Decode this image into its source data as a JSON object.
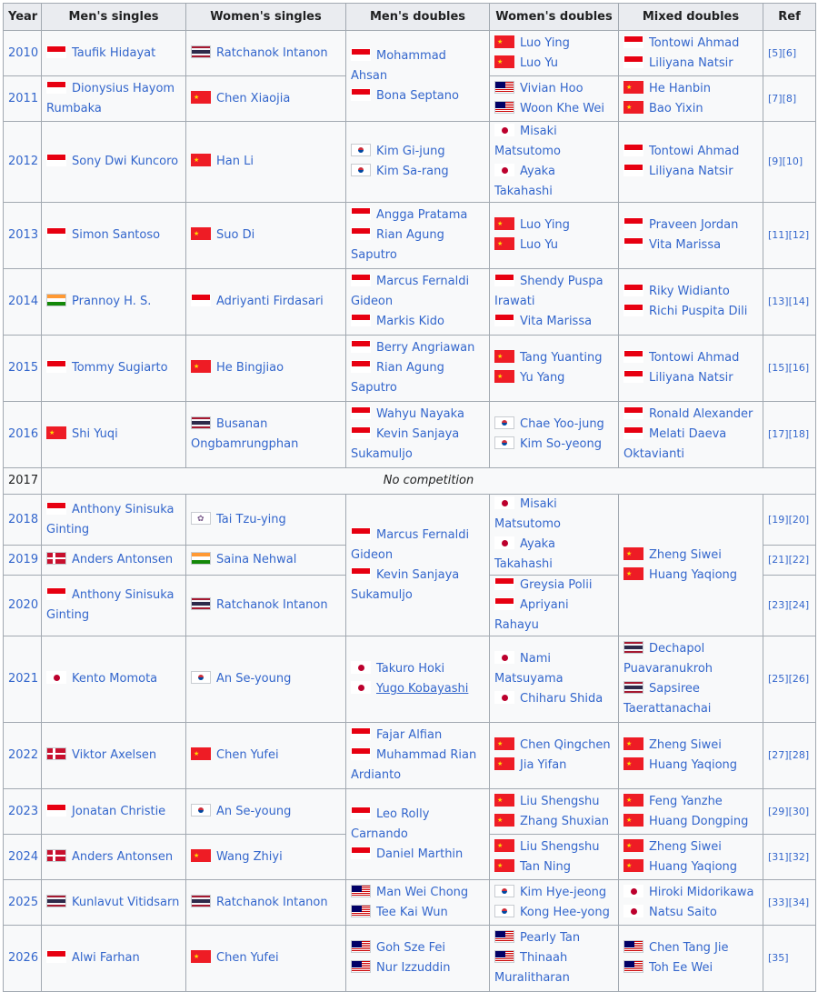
{
  "headers": [
    "Year",
    "Men's singles",
    "Women's singles",
    "Men's doubles",
    "Women's doubles",
    "Mixed doubles",
    "Ref"
  ],
  "no_competition": "No competition",
  "rows": [
    {
      "year": "2010",
      "ms": {
        "f": "IDN",
        "n": "Taufik Hidayat"
      },
      "ws": {
        "f": "THA",
        "n": "Ratchanok Intanon"
      },
      "md": [
        {
          "f": "IDN",
          "n": "Mohammad Ahsan"
        },
        {
          "f": "IDN",
          "n": "Bona Septano"
        }
      ],
      "wd": [
        {
          "f": "CHN",
          "n": "Luo Ying"
        },
        {
          "f": "CHN",
          "n": "Luo Yu"
        }
      ],
      "xd": [
        {
          "f": "IDN",
          "n": "Tontowi Ahmad"
        },
        {
          "f": "IDN",
          "n": "Liliyana Natsir"
        }
      ],
      "ref": "[5][6]"
    },
    {
      "year": "2011",
      "ms": {
        "f": "IDN",
        "n": "Dionysius Hayom Rumbaka"
      },
      "ws": {
        "f": "CHN",
        "n": "Chen Xiaojia"
      },
      "wd": [
        {
          "f": "MAS",
          "n": "Vivian Hoo"
        },
        {
          "f": "MAS",
          "n": "Woon Khe Wei"
        }
      ],
      "xd": [
        {
          "f": "CHN",
          "n": "He Hanbin"
        },
        {
          "f": "CHN",
          "n": "Bao Yixin"
        }
      ],
      "ref": "[7][8]"
    },
    {
      "year": "2012",
      "ms": {
        "f": "IDN",
        "n": "Sony Dwi Kuncoro"
      },
      "ws": {
        "f": "CHN",
        "n": "Han Li"
      },
      "md": [
        {
          "f": "KOR",
          "n": "Kim Gi-jung"
        },
        {
          "f": "KOR",
          "n": "Kim Sa-rang"
        }
      ],
      "wd": [
        {
          "f": "JPN",
          "n": "Misaki Matsutomo"
        },
        {
          "f": "JPN",
          "n": "Ayaka Takahashi"
        }
      ],
      "xd": [
        {
          "f": "IDN",
          "n": "Tontowi Ahmad"
        },
        {
          "f": "IDN",
          "n": "Liliyana Natsir"
        }
      ],
      "ref": "[9][10]"
    },
    {
      "year": "2013",
      "ms": {
        "f": "IDN",
        "n": "Simon Santoso"
      },
      "ws": {
        "f": "CHN",
        "n": "Suo Di"
      },
      "md": [
        {
          "f": "IDN",
          "n": "Angga Pratama"
        },
        {
          "f": "IDN",
          "n": "Rian Agung Saputro"
        }
      ],
      "wd": [
        {
          "f": "CHN",
          "n": "Luo Ying"
        },
        {
          "f": "CHN",
          "n": "Luo Yu"
        }
      ],
      "xd": [
        {
          "f": "IDN",
          "n": "Praveen Jordan"
        },
        {
          "f": "IDN",
          "n": "Vita Marissa"
        }
      ],
      "ref": "[11][12]"
    },
    {
      "year": "2014",
      "ms": {
        "f": "IND",
        "n": "Prannoy H. S."
      },
      "ws": {
        "f": "IDN",
        "n": "Adriyanti Firdasari"
      },
      "md": [
        {
          "f": "IDN",
          "n": "Marcus Fernaldi Gideon"
        },
        {
          "f": "IDN",
          "n": "Markis Kido"
        }
      ],
      "wd": [
        {
          "f": "IDN",
          "n": "Shendy Puspa Irawati"
        },
        {
          "f": "IDN",
          "n": "Vita Marissa"
        }
      ],
      "xd": [
        {
          "f": "IDN",
          "n": "Riky Widianto"
        },
        {
          "f": "IDN",
          "n": "Richi Puspita Dili"
        }
      ],
      "ref": "[13][14]"
    },
    {
      "year": "2015",
      "ms": {
        "f": "IDN",
        "n": "Tommy Sugiarto"
      },
      "ws": {
        "f": "CHN",
        "n": "He Bingjiao"
      },
      "md": [
        {
          "f": "IDN",
          "n": "Berry Angriawan"
        },
        {
          "f": "IDN",
          "n": "Rian Agung Saputro"
        }
      ],
      "wd": [
        {
          "f": "CHN",
          "n": "Tang Yuanting"
        },
        {
          "f": "CHN",
          "n": "Yu Yang"
        }
      ],
      "xd": [
        {
          "f": "IDN",
          "n": "Tontowi Ahmad"
        },
        {
          "f": "IDN",
          "n": "Liliyana Natsir"
        }
      ],
      "ref": "[15][16]"
    },
    {
      "year": "2016",
      "ms": {
        "f": "CHN",
        "n": "Shi Yuqi"
      },
      "ws": {
        "f": "THA",
        "n": "Busanan Ongbamrungphan"
      },
      "md": [
        {
          "f": "IDN",
          "n": "Wahyu Nayaka"
        },
        {
          "f": "IDN",
          "n": "Kevin Sanjaya Sukamuljo"
        }
      ],
      "wd": [
        {
          "f": "KOR",
          "n": "Chae Yoo-jung"
        },
        {
          "f": "KOR",
          "n": "Kim So-yeong"
        }
      ],
      "xd": [
        {
          "f": "IDN",
          "n": "Ronald Alexander"
        },
        {
          "f": "IDN",
          "n": "Melati Daeva Oktavianti"
        }
      ],
      "ref": "[17][18]"
    },
    {
      "year": "2017"
    },
    {
      "year": "2018",
      "ms": {
        "f": "IDN",
        "n": "Anthony Sinisuka Ginting"
      },
      "ws": {
        "f": "TPE",
        "n": "Tai Tzu-ying"
      },
      "md": [
        {
          "f": "IDN",
          "n": "Marcus Fernaldi Gideon"
        },
        {
          "f": "IDN",
          "n": "Kevin Sanjaya Sukamuljo"
        }
      ],
      "wd": [
        {
          "f": "JPN",
          "n": "Misaki Matsutomo"
        },
        {
          "f": "JPN",
          "n": "Ayaka Takahashi"
        }
      ],
      "xd": [
        {
          "f": "CHN",
          "n": "Zheng Siwei"
        },
        {
          "f": "CHN",
          "n": "Huang Yaqiong"
        }
      ],
      "ref": "[19][20]"
    },
    {
      "year": "2019",
      "ms": {
        "f": "DEN",
        "n": "Anders Antonsen"
      },
      "ws": {
        "f": "IND",
        "n": "Saina Nehwal"
      },
      "ref": "[21][22]"
    },
    {
      "year": "2020",
      "ms": {
        "f": "IDN",
        "n": "Anthony Sinisuka Ginting"
      },
      "ws": {
        "f": "THA",
        "n": "Ratchanok Intanon"
      },
      "wd": [
        {
          "f": "IDN",
          "n": "Greysia Polii"
        },
        {
          "f": "IDN",
          "n": "Apriyani Rahayu"
        }
      ],
      "ref": "[23][24]"
    },
    {
      "year": "2021",
      "ms": {
        "f": "JPN",
        "n": "Kento Momota"
      },
      "ws": {
        "f": "KOR",
        "n": "An Se-young"
      },
      "md": [
        {
          "f": "JPN",
          "n": "Takuro Hoki"
        },
        {
          "f": "JPN",
          "n": "Yugo Kobayashi"
        }
      ],
      "wd": [
        {
          "f": "JPN",
          "n": "Nami Matsuyama"
        },
        {
          "f": "JPN",
          "n": "Chiharu Shida"
        }
      ],
      "xd": [
        {
          "f": "THA",
          "n": "Dechapol Puavaranukroh"
        },
        {
          "f": "THA",
          "n": "Sapsiree Taerattanachai"
        }
      ],
      "ref": "[25][26]"
    },
    {
      "year": "2022",
      "ms": {
        "f": "DEN",
        "n": "Viktor Axelsen"
      },
      "ws": {
        "f": "CHN",
        "n": "Chen Yufei"
      },
      "md": [
        {
          "f": "IDN",
          "n": "Fajar Alfian"
        },
        {
          "f": "IDN",
          "n": "Muhammad Rian Ardianto"
        }
      ],
      "wd": [
        {
          "f": "CHN",
          "n": "Chen Qingchen"
        },
        {
          "f": "CHN",
          "n": "Jia Yifan"
        }
      ],
      "xd": [
        {
          "f": "CHN",
          "n": "Zheng Siwei"
        },
        {
          "f": "CHN",
          "n": "Huang Yaqiong"
        }
      ],
      "ref": "[27][28]"
    },
    {
      "year": "2023",
      "ms": {
        "f": "IDN",
        "n": "Jonatan Christie"
      },
      "ws": {
        "f": "KOR",
        "n": "An Se-young"
      },
      "md": [
        {
          "f": "IDN",
          "n": "Leo Rolly Carnando"
        },
        {
          "f": "IDN",
          "n": "Daniel Marthin"
        }
      ],
      "wd": [
        {
          "f": "CHN",
          "n": "Liu Shengshu"
        },
        {
          "f": "CHN",
          "n": "Zhang Shuxian"
        }
      ],
      "xd": [
        {
          "f": "CHN",
          "n": "Feng Yanzhe"
        },
        {
          "f": "CHN",
          "n": "Huang Dongping"
        }
      ],
      "ref": "[29][30]"
    },
    {
      "year": "2024",
      "ms": {
        "f": "DEN",
        "n": "Anders Antonsen"
      },
      "ws": {
        "f": "CHN",
        "n": "Wang Zhiyi"
      },
      "wd": [
        {
          "f": "CHN",
          "n": "Liu Shengshu"
        },
        {
          "f": "CHN",
          "n": "Tan Ning"
        }
      ],
      "xd": [
        {
          "f": "CHN",
          "n": "Zheng Siwei"
        },
        {
          "f": "CHN",
          "n": "Huang Yaqiong"
        }
      ],
      "ref": "[31][32]"
    },
    {
      "year": "2025",
      "ms": {
        "f": "THA",
        "n": "Kunlavut Vitidsarn"
      },
      "ws": {
        "f": "THA",
        "n": "Ratchanok Intanon"
      },
      "md": [
        {
          "f": "MAS",
          "n": "Man Wei Chong"
        },
        {
          "f": "MAS",
          "n": "Tee Kai Wun"
        }
      ],
      "wd": [
        {
          "f": "KOR",
          "n": "Kim Hye-jeong"
        },
        {
          "f": "KOR",
          "n": "Kong Hee-yong"
        }
      ],
      "xd": [
        {
          "f": "JPN",
          "n": "Hiroki Midorikawa"
        },
        {
          "f": "JPN",
          "n": "Natsu Saito"
        }
      ],
      "ref": "[33][34]"
    },
    {
      "year": "2026",
      "ms": {
        "f": "IDN",
        "n": "Alwi Farhan"
      },
      "ws": {
        "f": "CHN",
        "n": "Chen Yufei"
      },
      "md": [
        {
          "f": "MAS",
          "n": "Goh Sze Fei"
        },
        {
          "f": "MAS",
          "n": "Nur Izzuddin"
        }
      ],
      "wd": [
        {
          "f": "MAS",
          "n": "Pearly Tan"
        },
        {
          "f": "MAS",
          "n": "Thinaah Muralitharan"
        }
      ],
      "xd": [
        {
          "f": "MAS",
          "n": "Chen Tang Jie"
        },
        {
          "f": "MAS",
          "n": "Toh Ee Wei"
        }
      ],
      "ref": "[35]"
    }
  ]
}
